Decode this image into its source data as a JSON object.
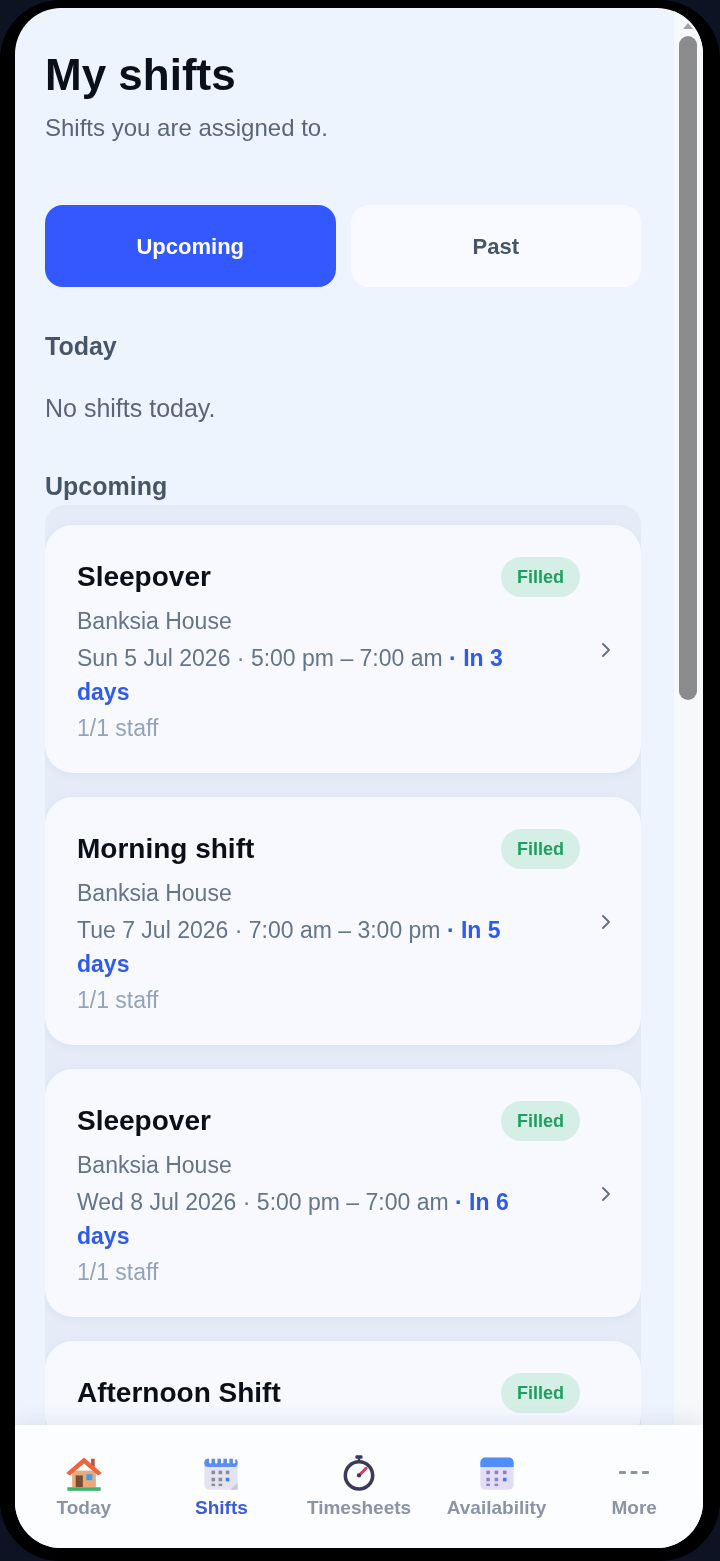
{
  "page": {
    "title": "My shifts",
    "subtitle": "Shifts you are assigned to."
  },
  "tabs": [
    {
      "label": "Upcoming",
      "selected": true
    },
    {
      "label": "Past",
      "selected": false
    }
  ],
  "today": {
    "heading": "Today",
    "empty_message": "No shifts today."
  },
  "upcoming": {
    "heading": "Upcoming",
    "shifts": [
      {
        "title": "Sleepover",
        "status": "Filled",
        "location": "Banksia House",
        "when": "Sun 5 Jul 2026 · 5:00 pm – 7:00 am",
        "relative": "· In 3 days",
        "staff": "1/1 staff"
      },
      {
        "title": "Morning shift",
        "status": "Filled",
        "location": "Banksia House",
        "when": "Tue 7 Jul 2026 · 7:00 am – 3:00 pm",
        "relative": "· In 5 days",
        "staff": "1/1 staff"
      },
      {
        "title": "Sleepover",
        "status": "Filled",
        "location": "Banksia House",
        "when": "Wed 8 Jul 2026 · 5:00 pm – 7:00 am",
        "relative": "· In 6 days",
        "staff": "1/1 staff"
      },
      {
        "title": "Afternoon Shift",
        "status": "Filled"
      }
    ]
  },
  "nav": [
    {
      "label": "Today",
      "selected": false
    },
    {
      "label": "Shifts",
      "selected": true
    },
    {
      "label": "Timesheets",
      "selected": false
    },
    {
      "label": "Availability",
      "selected": false
    },
    {
      "label": "More",
      "selected": false
    }
  ]
}
